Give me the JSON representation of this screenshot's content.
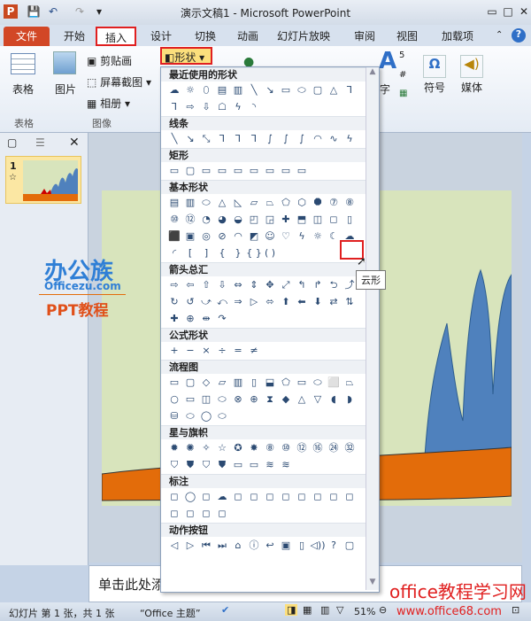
{
  "window": {
    "title": "演示文稿1 - Microsoft PowerPoint",
    "app_icon": "P",
    "controls": [
      "▭",
      "□",
      "✕"
    ]
  },
  "quick_access": [
    "save-icon",
    "undo-icon",
    "redo-icon",
    "customize-icon"
  ],
  "tabs": [
    {
      "label": "文件"
    },
    {
      "label": "开始"
    },
    {
      "label": "插入"
    },
    {
      "label": "设计"
    },
    {
      "label": "切换"
    },
    {
      "label": "动画"
    },
    {
      "label": "幻灯片放映"
    },
    {
      "label": "审阅"
    },
    {
      "label": "视图"
    },
    {
      "label": "加载项"
    }
  ],
  "ribbon": {
    "table": "表格",
    "table_group": "表格",
    "picture": "图片",
    "clipart": "剪贴画",
    "screenshot": "屏幕截图",
    "album": "相册",
    "image_group": "图像",
    "shapes": "形状",
    "text_partial": "字",
    "symbol": "符号",
    "media": "媒体"
  },
  "shapes_menu": {
    "sections": [
      {
        "title": "最近使用的形状",
        "shapes": [
          "☁",
          "☼",
          "⬯",
          "▤",
          "▥",
          "╲",
          "↘",
          "▭",
          "⬭",
          "▢",
          "△",
          "⅂",
          "⅂",
          "⇨",
          "⇩",
          "☖",
          "ϟ",
          "◝"
        ]
      },
      {
        "title": "线条",
        "shapes": [
          "╲",
          "↘",
          "⤡",
          "⅂",
          "⅂",
          "⅂",
          "∫",
          "∫",
          "∫",
          "◠",
          "∿",
          "ϟ"
        ]
      },
      {
        "title": "矩形",
        "shapes": [
          "▭",
          "▢",
          "▭",
          "▭",
          "▭",
          "▭",
          "▭",
          "▭",
          "▭"
        ]
      },
      {
        "title": "基本形状",
        "shapes": [
          "▤",
          "▥",
          "⬭",
          "△",
          "◺",
          "▱",
          "⏢",
          "⬠",
          "⬡",
          "⯃",
          "⑦",
          "⑧",
          "⑩",
          "⑫",
          "◔",
          "◕",
          "◒",
          "◰",
          "◲",
          "✚",
          "⬒",
          "◫",
          "◻",
          "▯",
          "⬛",
          "▣",
          "◎",
          "⊘",
          "◠",
          "◩",
          "☺",
          "♡",
          "ϟ",
          "☼",
          "☾",
          "☁",
          "◜",
          "[",
          "]",
          "{",
          "}",
          "{ }",
          "( )"
        ]
      },
      {
        "title": "箭头总汇",
        "shapes": [
          "⇨",
          "⇦",
          "⇧",
          "⇩",
          "⇔",
          "⇕",
          "✥",
          "⤢",
          "↰",
          "↱",
          "⮌",
          "⤴",
          "↻",
          "↺",
          "⤻",
          "⤺",
          "⇒",
          "▷",
          "⬄",
          "⬆",
          "⬅",
          "⬇",
          "⇄",
          "⇅",
          "✚",
          "⊕",
          "⇹",
          "↷"
        ]
      },
      {
        "title": "公式形状",
        "shapes": [
          "+",
          "−",
          "×",
          "÷",
          "=",
          "≠"
        ]
      },
      {
        "title": "流程图",
        "shapes": [
          "▭",
          "▢",
          "◇",
          "▱",
          "▥",
          "▯",
          "⬓",
          "⬠",
          "▭",
          "⬭",
          "⬜",
          "⏢",
          "○",
          "▭",
          "◫",
          "⬭",
          "⊗",
          "⊕",
          "⧗",
          "◆",
          "△",
          "▽",
          "◖",
          "◗",
          "⛁",
          "⬭",
          "◯",
          "⬭"
        ]
      },
      {
        "title": "星与旗帜",
        "shapes": [
          "✹",
          "✺",
          "✧",
          "☆",
          "✪",
          "✸",
          "⑧",
          "⑩",
          "⑫",
          "⑯",
          "㉔",
          "㉜",
          "⛉",
          "⛊",
          "⛉",
          "⛊",
          "▭",
          "▭",
          "≋",
          "≋"
        ]
      },
      {
        "title": "标注",
        "shapes": [
          "◻",
          "◯",
          "◻",
          "☁",
          "◻",
          "◻",
          "◻",
          "◻",
          "◻",
          "◻",
          "◻",
          "◻",
          "◻",
          "◻",
          "◻",
          "◻"
        ]
      },
      {
        "title": "动作按钮",
        "shapes": [
          "◁",
          "▷",
          "⏮",
          "⏭",
          "⌂",
          "ⓘ",
          "↩",
          "▣",
          "▯",
          "◁))",
          "?",
          "▢"
        ]
      }
    ],
    "tooltip": "云形"
  },
  "slides_pane": {
    "slide_number": "1",
    "star": "☆"
  },
  "watermark": {
    "logo": "办公族",
    "site": "Officezu.com",
    "sub": "PPT教程"
  },
  "notes": {
    "placeholder": "单击此处添加备注"
  },
  "status": {
    "slide_info": "幻灯片 第 1 张，共 1 张",
    "theme": "“Office 主题”",
    "zoom": "51%"
  },
  "overlay": {
    "brand": "office教程学习网",
    "url": "www.office68.com"
  },
  "colors": {
    "file_tab": "#d24726",
    "highlight": "#e02020",
    "slide_bg": "#d8e4bc",
    "mountain": "#4f81bd",
    "ground": "#e36c0a"
  }
}
